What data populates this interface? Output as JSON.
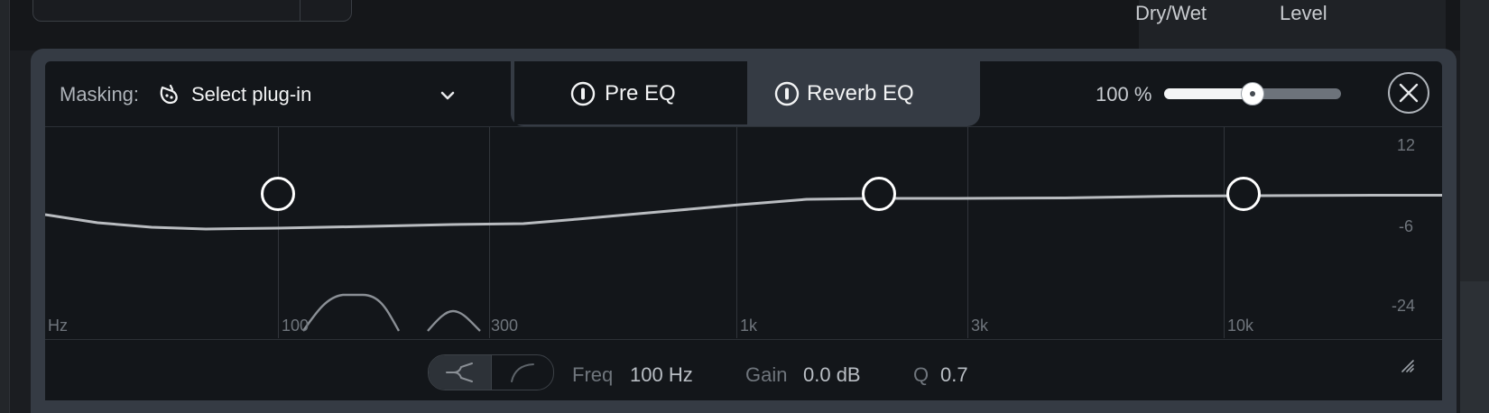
{
  "top_bar": {
    "dry_wet_label": "Dry/Wet",
    "level_label": "Level"
  },
  "header": {
    "masking_label": "Masking:",
    "plugin_select": {
      "value": "Select plug-in",
      "icon": "mask-icon"
    },
    "tabs": [
      {
        "label": "Pre EQ",
        "active": true,
        "icon": "power-icon"
      },
      {
        "label": "Reverb EQ",
        "active": false,
        "icon": "power-icon"
      }
    ],
    "mix_percent_label": "100 %",
    "mix_slider_value": 0.5,
    "close_icon": "close-icon"
  },
  "graph": {
    "x_labels": [
      "Hz",
      "100",
      "300",
      "1k",
      "3k",
      "10k"
    ],
    "y_labels": [
      "12",
      "-6",
      "-24"
    ]
  },
  "params": {
    "freq_label": "Freq",
    "freq_value": "100 Hz",
    "gain_label": "Gain",
    "gain_value": "0.0 dB",
    "q_label": "Q",
    "q_value": "0.7"
  },
  "colors": {
    "panel": "#353b44",
    "graph_bg": "#13161a",
    "curve": "#b9bcc0",
    "node": "#ffffff"
  }
}
